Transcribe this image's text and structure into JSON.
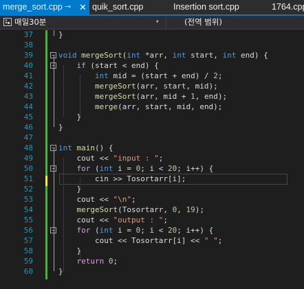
{
  "tabs": [
    {
      "label": "merge_sort.cpp",
      "active": true,
      "pin": "⊸",
      "close": "✕"
    },
    {
      "label": "quik_sort.cpp",
      "active": false
    },
    {
      "label": "Insertion sort.cpp",
      "active": false
    },
    {
      "label": "1764.cpp",
      "active": false
    }
  ],
  "nav": {
    "project": "매일30분",
    "scope": "(전역 범위)",
    "dropdown_glyph": "▾"
  },
  "code_lines": [
    {
      "n": "37",
      "tokens": [
        [
          "}",
          ""
        ]
      ]
    },
    {
      "n": "38",
      "tokens": []
    },
    {
      "n": "39",
      "tokens": [
        [
          "void",
          "kw"
        ],
        [
          " ",
          ""
        ],
        [
          "mergeSort",
          "fn"
        ],
        [
          "(",
          ""
        ],
        [
          "int",
          "kw"
        ],
        [
          " *arr, ",
          ""
        ],
        [
          "int",
          "kw"
        ],
        [
          " start, ",
          ""
        ],
        [
          "int",
          "kw"
        ],
        [
          " end) {",
          ""
        ]
      ]
    },
    {
      "n": "40",
      "tokens": [
        [
          "    ",
          ""
        ],
        [
          "if",
          "ctl"
        ],
        [
          " (start < end) {",
          ""
        ]
      ]
    },
    {
      "n": "41",
      "tokens": [
        [
          "        ",
          ""
        ],
        [
          "int",
          "kw"
        ],
        [
          " mid = (start + end) / ",
          ""
        ],
        [
          "2",
          "num"
        ],
        [
          ";",
          ""
        ]
      ]
    },
    {
      "n": "42",
      "tokens": [
        [
          "        ",
          ""
        ],
        [
          "mergeSort",
          "fn"
        ],
        [
          "(arr, start, mid);",
          ""
        ]
      ]
    },
    {
      "n": "43",
      "tokens": [
        [
          "        ",
          ""
        ],
        [
          "mergeSort",
          "fn"
        ],
        [
          "(arr, mid + ",
          ""
        ],
        [
          "1",
          "num"
        ],
        [
          ", end);",
          ""
        ]
      ]
    },
    {
      "n": "44",
      "tokens": [
        [
          "        ",
          ""
        ],
        [
          "merge",
          "fn"
        ],
        [
          "(arr, start, mid, end);",
          ""
        ]
      ]
    },
    {
      "n": "45",
      "tokens": [
        [
          "    }",
          ""
        ]
      ]
    },
    {
      "n": "46",
      "tokens": [
        [
          "}",
          ""
        ]
      ]
    },
    {
      "n": "47",
      "tokens": []
    },
    {
      "n": "48",
      "tokens": [
        [
          "int",
          "kw"
        ],
        [
          " ",
          ""
        ],
        [
          "main",
          "fn"
        ],
        [
          "() {",
          ""
        ]
      ]
    },
    {
      "n": "49",
      "tokens": [
        [
          "    cout << ",
          ""
        ],
        [
          "\"input : \"",
          "str"
        ],
        [
          ";",
          ""
        ]
      ]
    },
    {
      "n": "50",
      "tokens": [
        [
          "    ",
          ""
        ],
        [
          "for",
          "ctl"
        ],
        [
          " (",
          ""
        ],
        [
          "int",
          "kw"
        ],
        [
          " i = ",
          ""
        ],
        [
          "0",
          "num"
        ],
        [
          "; i < ",
          ""
        ],
        [
          "20",
          "num"
        ],
        [
          "; i++) {",
          ""
        ]
      ]
    },
    {
      "n": "51",
      "tokens": [
        [
          "        cin >> Tosortarr[i];",
          ""
        ]
      ]
    },
    {
      "n": "52",
      "tokens": [
        [
          "    }",
          ""
        ]
      ]
    },
    {
      "n": "53",
      "tokens": [
        [
          "    cout << ",
          ""
        ],
        [
          "\"\\n\"",
          "str"
        ],
        [
          ";",
          ""
        ]
      ]
    },
    {
      "n": "54",
      "tokens": [
        [
          "    ",
          ""
        ],
        [
          "mergeSort",
          "fn"
        ],
        [
          "(Tosortarr, ",
          ""
        ],
        [
          "0",
          "num"
        ],
        [
          ", ",
          ""
        ],
        [
          "19",
          "num"
        ],
        [
          ");",
          ""
        ]
      ]
    },
    {
      "n": "55",
      "tokens": [
        [
          "    cout << ",
          ""
        ],
        [
          "\"output : \"",
          "str"
        ],
        [
          ";",
          ""
        ]
      ]
    },
    {
      "n": "56",
      "tokens": [
        [
          "    ",
          ""
        ],
        [
          "for",
          "ctl"
        ],
        [
          " (",
          ""
        ],
        [
          "int",
          "kw"
        ],
        [
          " i = ",
          ""
        ],
        [
          "0",
          "num"
        ],
        [
          "; i < ",
          ""
        ],
        [
          "20",
          "num"
        ],
        [
          "; i++) {",
          ""
        ]
      ]
    },
    {
      "n": "57",
      "tokens": [
        [
          "        cout << Tosortarr[i] << ",
          ""
        ],
        [
          "\" \"",
          "str"
        ],
        [
          ";",
          ""
        ]
      ]
    },
    {
      "n": "58",
      "tokens": [
        [
          "    }",
          ""
        ]
      ]
    },
    {
      "n": "59",
      "tokens": [
        [
          "    ",
          ""
        ],
        [
          "return",
          "ctl"
        ],
        [
          " ",
          ""
        ],
        [
          "0",
          "num"
        ],
        [
          ";",
          ""
        ]
      ]
    },
    {
      "n": "60",
      "tokens": [
        [
          "}",
          ""
        ]
      ]
    }
  ],
  "colors": {
    "keyword": "#569cd6",
    "control": "#d8a0df",
    "function": "#dcdcaa",
    "string": "#d69d85",
    "number": "#b5cea8",
    "line_number": "#2b91af",
    "accent": "#007acc",
    "saved_change": "#57a64a",
    "unsaved_change": "#efe66b"
  }
}
